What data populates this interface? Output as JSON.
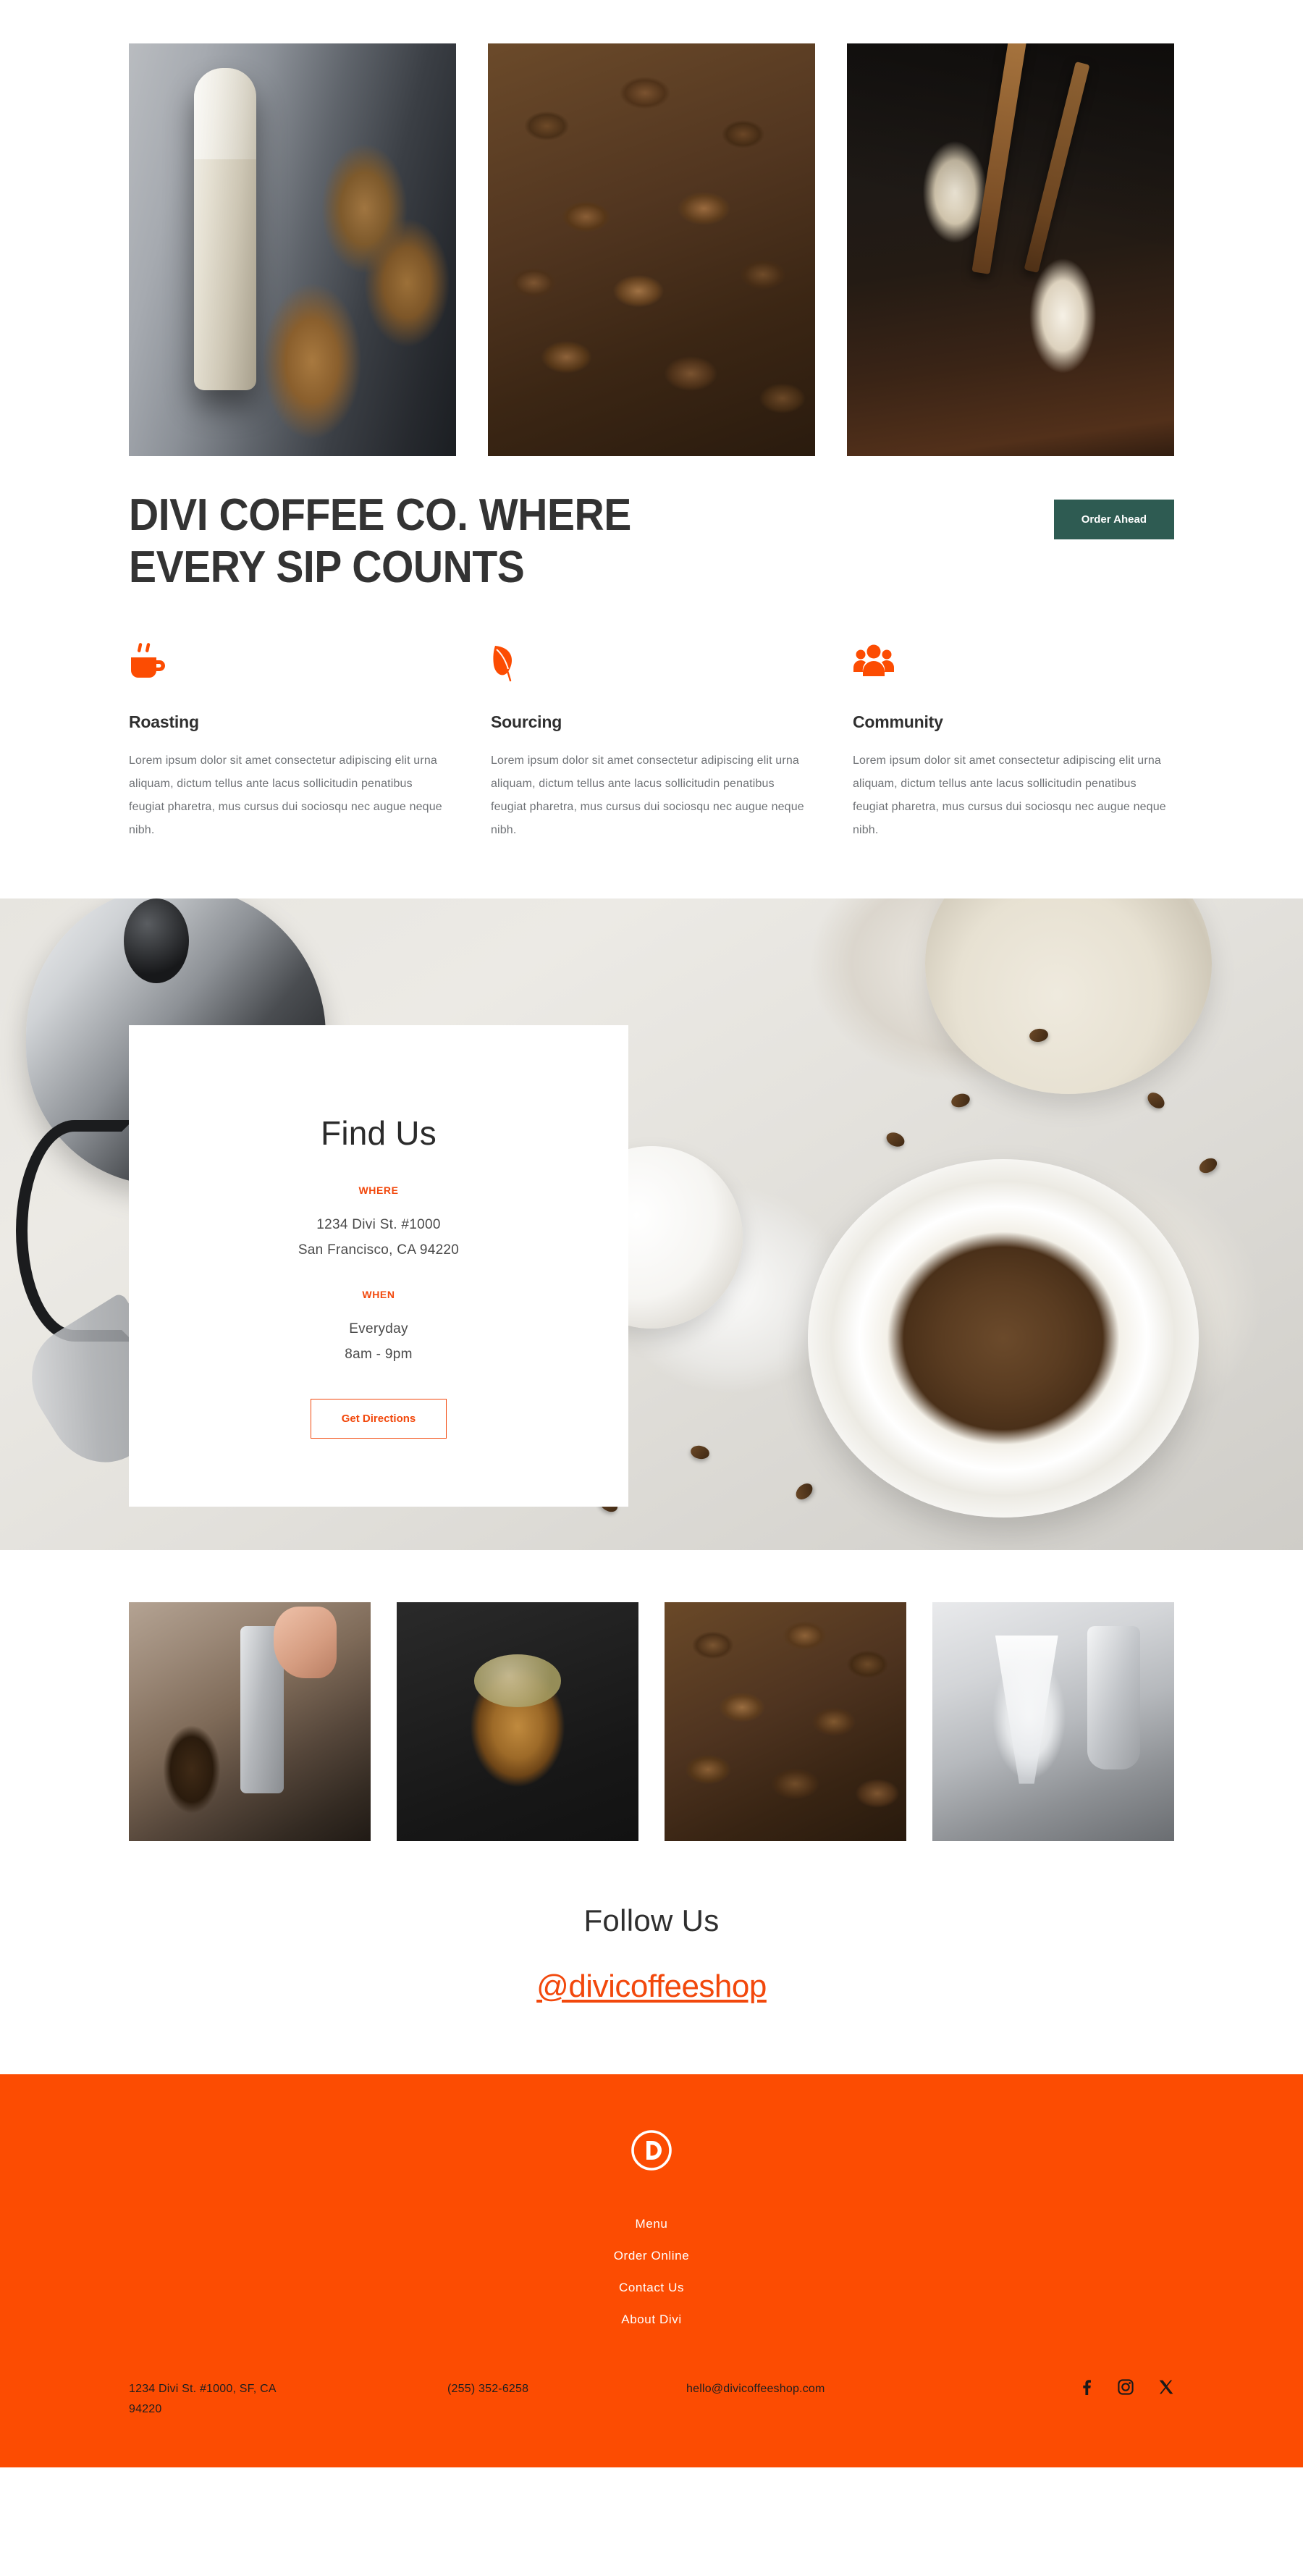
{
  "theme": {
    "orange": "#FC4C02",
    "teal": "#2E5B52",
    "dark_text": "#333333",
    "body_text": "#6F7276"
  },
  "hero": {
    "images": [
      {
        "alt": "muffins-and-milk-bottle",
        "icon": "photo-muffins-milk"
      },
      {
        "alt": "roasted-coffee-beans-closeup",
        "icon": "photo-beans"
      },
      {
        "alt": "iced-coffee-with-cinnamon-sticks",
        "icon": "photo-iced"
      }
    ],
    "headline_line1": "DIVI COFFEE CO. WHERE",
    "headline_line2": "EVERY SIP COUNTS",
    "cta_label": "Order Ahead"
  },
  "features": [
    {
      "icon": "coffee-cup-icon",
      "title": "Roasting",
      "body": "Lorem ipsum dolor sit amet consectetur adipiscing elit urna aliquam, dictum tellus ante lacus sollicitudin penatibus feugiat pharetra, mus cursus dui sociosqu nec augue neque nibh."
    },
    {
      "icon": "leaf-icon",
      "title": "Sourcing",
      "body": "Lorem ipsum dolor sit amet consectetur adipiscing elit urna aliquam, dictum tellus ante lacus sollicitudin penatibus feugiat pharetra, mus cursus dui sociosqu nec augue neque nibh."
    },
    {
      "icon": "people-group-icon",
      "title": "Community",
      "body": "Lorem ipsum dolor sit amet consectetur adipiscing elit urna aliquam, dictum tellus ante lacus sollicitudin penatibus feugiat pharetra, mus cursus dui sociosqu nec augue neque nibh."
    }
  ],
  "find_us": {
    "title": "Find Us",
    "where_label": "WHERE",
    "address_line1": "1234 Divi St. #1000",
    "address_line2": "San Francisco, CA 94220",
    "when_label": "WHEN",
    "hours_line1": "Everyday",
    "hours_line2": "8am - 9pm",
    "cta_label": "Get Directions"
  },
  "gallery": [
    {
      "alt": "barista-tamping-espresso",
      "icon": "gal-grinder"
    },
    {
      "alt": "seeded-muffin-on-slate",
      "icon": "gal-muffin"
    },
    {
      "alt": "coffee-beans-pile",
      "icon": "gal-beans"
    },
    {
      "alt": "glass-pour-over-carafe",
      "icon": "gal-pour"
    }
  ],
  "follow": {
    "title": "Follow Us",
    "handle": "@divicoffeeshop"
  },
  "footer": {
    "logo": "divi-d-logo",
    "nav": [
      {
        "label": "Menu"
      },
      {
        "label": "Order Online"
      },
      {
        "label": "Contact Us"
      },
      {
        "label": "About Divi"
      }
    ],
    "address_line1": "1234 Divi St. #1000, SF, CA",
    "address_line2": "94220",
    "phone": "(255) 352-6258",
    "email": "hello@divicoffeeshop.com",
    "social": [
      {
        "name": "facebook-icon"
      },
      {
        "name": "instagram-icon"
      },
      {
        "name": "x-twitter-icon"
      }
    ]
  }
}
